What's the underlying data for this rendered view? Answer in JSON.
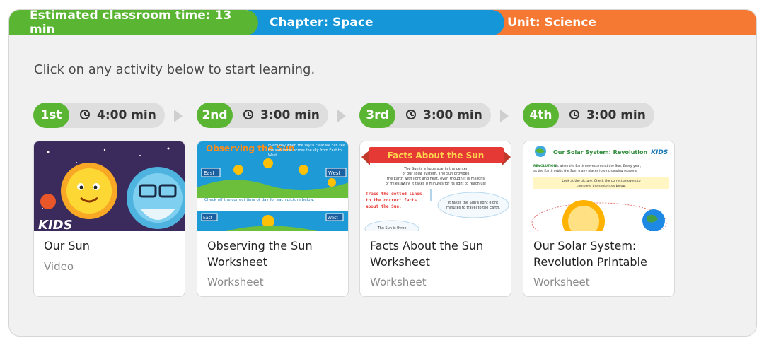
{
  "header": {
    "time_label": "Estimated classroom time: 13 min",
    "chapter_label": "Chapter: Space",
    "unit_label": "Unit: Science"
  },
  "intro_text": "Click on any activity below to start learning.",
  "steps": [
    {
      "order": "1st",
      "time": "4:00 min"
    },
    {
      "order": "2nd",
      "time": "3:00 min"
    },
    {
      "order": "3rd",
      "time": "3:00 min"
    },
    {
      "order": "4th",
      "time": "3:00 min"
    }
  ],
  "activities": [
    {
      "title": "Our Sun",
      "type": "Video",
      "thumb_logo": "KIDS"
    },
    {
      "title": "Observing the Sun Worksheet",
      "type": "Worksheet",
      "thumb_heading": "Observing the Sun",
      "thumb_text": "Every day when the sky is clear we can see the sun move across the sky from East to West.",
      "thumb_east": "East",
      "thumb_west": "West",
      "thumb_instruction": "Check off the correct time of day for each picture below.",
      "thumb_east2": "East",
      "thumb_west2": "West"
    },
    {
      "title": "Facts About the Sun Worksheet",
      "type": "Worksheet",
      "thumb_heading": "Facts About the Sun",
      "thumb_text1": "The Sun is a huge star in the center",
      "thumb_text2": "of our solar system. The Sun provides",
      "thumb_text3": "the Earth with light and heat, even though it is millions",
      "thumb_text4": "of miles away. It takes 8 minutes for its light to reach us!",
      "thumb_trace1": "Trace the dotted lines",
      "thumb_trace2": "to the correct facts",
      "thumb_trace3": "about the Sun.",
      "thumb_cloud1": "It takes the Sun's light eight",
      "thumb_cloud2": "minutes to travel to the Earth.",
      "thumb_bottom": "The Sun is three"
    },
    {
      "title": "Our Solar System: Revolution Printable",
      "type": "Worksheet",
      "thumb_heading": "Our Solar System: Revolution",
      "thumb_logo": "KIDS",
      "thumb_bold": "REVOLUTION",
      "thumb_text1": "is when the Earth moves around the Sun. Every year,",
      "thumb_text2": "as the Earth orbits the Sun, many places have changing seasons.",
      "thumb_inst1": "Look at the picture. Check the correct answers to",
      "thumb_inst2": "complete the sentences below."
    }
  ],
  "colors": {
    "green": "#5ab533",
    "blue": "#1496d8",
    "orange": "#f57933",
    "panel_bg": "#f1f1f1"
  },
  "icons": [
    "clock-icon",
    "chevron-right-icon"
  ]
}
